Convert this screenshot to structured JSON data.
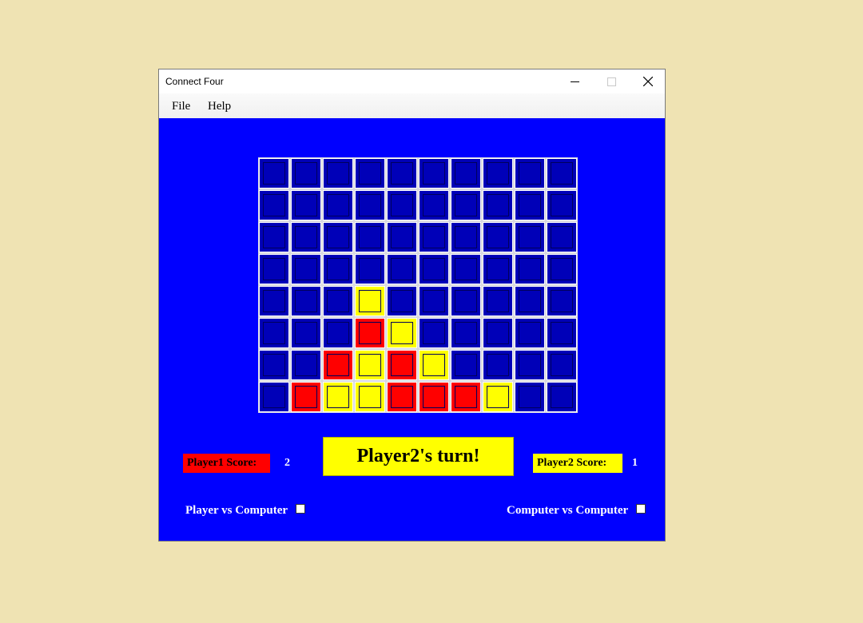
{
  "window": {
    "title": "Connect Four",
    "minimize_glyph": "—",
    "maximize_glyph": "☐",
    "close_glyph": "✕"
  },
  "menu": {
    "items": [
      "File",
      "Help"
    ]
  },
  "colors": {
    "board_blue": "#0000ff",
    "empty_cell": "#0000b8",
    "red": "#ff0000",
    "yellow": "#ffff00"
  },
  "board": {
    "rows": 8,
    "cols": 10,
    "cells": [
      [
        "",
        "",
        "",
        "",
        "",
        "",
        "",
        "",
        "",
        ""
      ],
      [
        "",
        "",
        "",
        "",
        "",
        "",
        "",
        "",
        "",
        ""
      ],
      [
        "",
        "",
        "",
        "",
        "",
        "",
        "",
        "",
        "",
        ""
      ],
      [
        "",
        "",
        "",
        "",
        "",
        "",
        "",
        "",
        "",
        ""
      ],
      [
        "",
        "",
        "",
        "Y",
        "",
        "",
        "",
        "",
        "",
        ""
      ],
      [
        "",
        "",
        "",
        "R",
        "Y",
        "",
        "",
        "",
        "",
        ""
      ],
      [
        "",
        "",
        "R",
        "Y",
        "R",
        "Y",
        "",
        "",
        "",
        ""
      ],
      [
        "",
        "R",
        "Y",
        "Y",
        "R",
        "R",
        "R",
        "Y",
        "",
        ""
      ]
    ]
  },
  "scores": {
    "player1_label": "Player1 Score:",
    "player1_value": "2",
    "player2_label": "Player2 Score:",
    "player2_value": "1"
  },
  "status": {
    "turn_text": "Player2's turn!"
  },
  "modes": {
    "pvc_label": "Player vs Computer",
    "pvc_checked": false,
    "cvc_label": "Computer vs Computer",
    "cvc_checked": false
  }
}
